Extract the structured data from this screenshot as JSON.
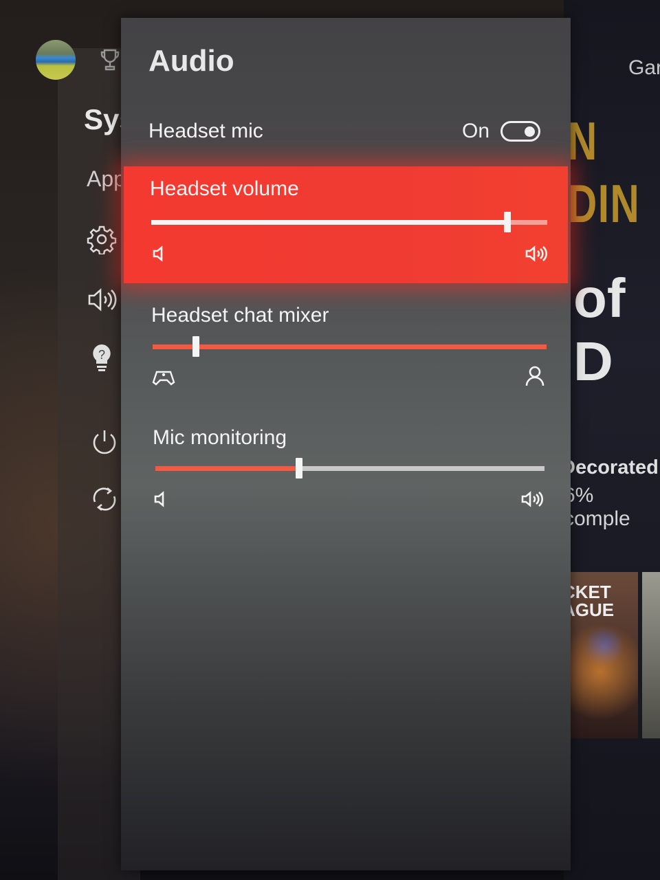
{
  "background": {
    "guide": {
      "section_title": "Sys",
      "apps_label": "App",
      "side_icons": [
        "gear-icon",
        "speaker-icon",
        "tips-icon",
        "power-icon",
        "restart-icon"
      ]
    },
    "home": {
      "tab_label": "Gar",
      "hero_title_partial": "N DIN",
      "game_title_partial": "of D",
      "achievement_title": "Decorated",
      "achievement_progress": "6% comple",
      "tile_title_line1": "CKET",
      "tile_title_line2": "AGUE"
    }
  },
  "audio_panel": {
    "title": "Audio",
    "headset_mic": {
      "label": "Headset mic",
      "state_label": "On",
      "enabled": true
    },
    "headset_volume": {
      "label": "Headset volume",
      "value_percent": 90,
      "min_icon": "speaker-low-icon",
      "max_icon": "speaker-high-icon",
      "focused": true
    },
    "headset_chat_mixer": {
      "label": "Headset chat mixer",
      "value_percent": 11,
      "min_icon": "controller-icon",
      "max_icon": "person-icon"
    },
    "mic_monitoring": {
      "label": "Mic monitoring",
      "value_percent": 37,
      "min_icon": "speaker-low-icon",
      "max_icon": "speaker-high-icon"
    }
  },
  "colors": {
    "accent": "#f43a30",
    "slider_fill": "#f25a44",
    "slider_empty": "#c8c8c8",
    "focused_track_fill": "#f4f4f4",
    "focused_track_empty": "#f6a09a"
  }
}
